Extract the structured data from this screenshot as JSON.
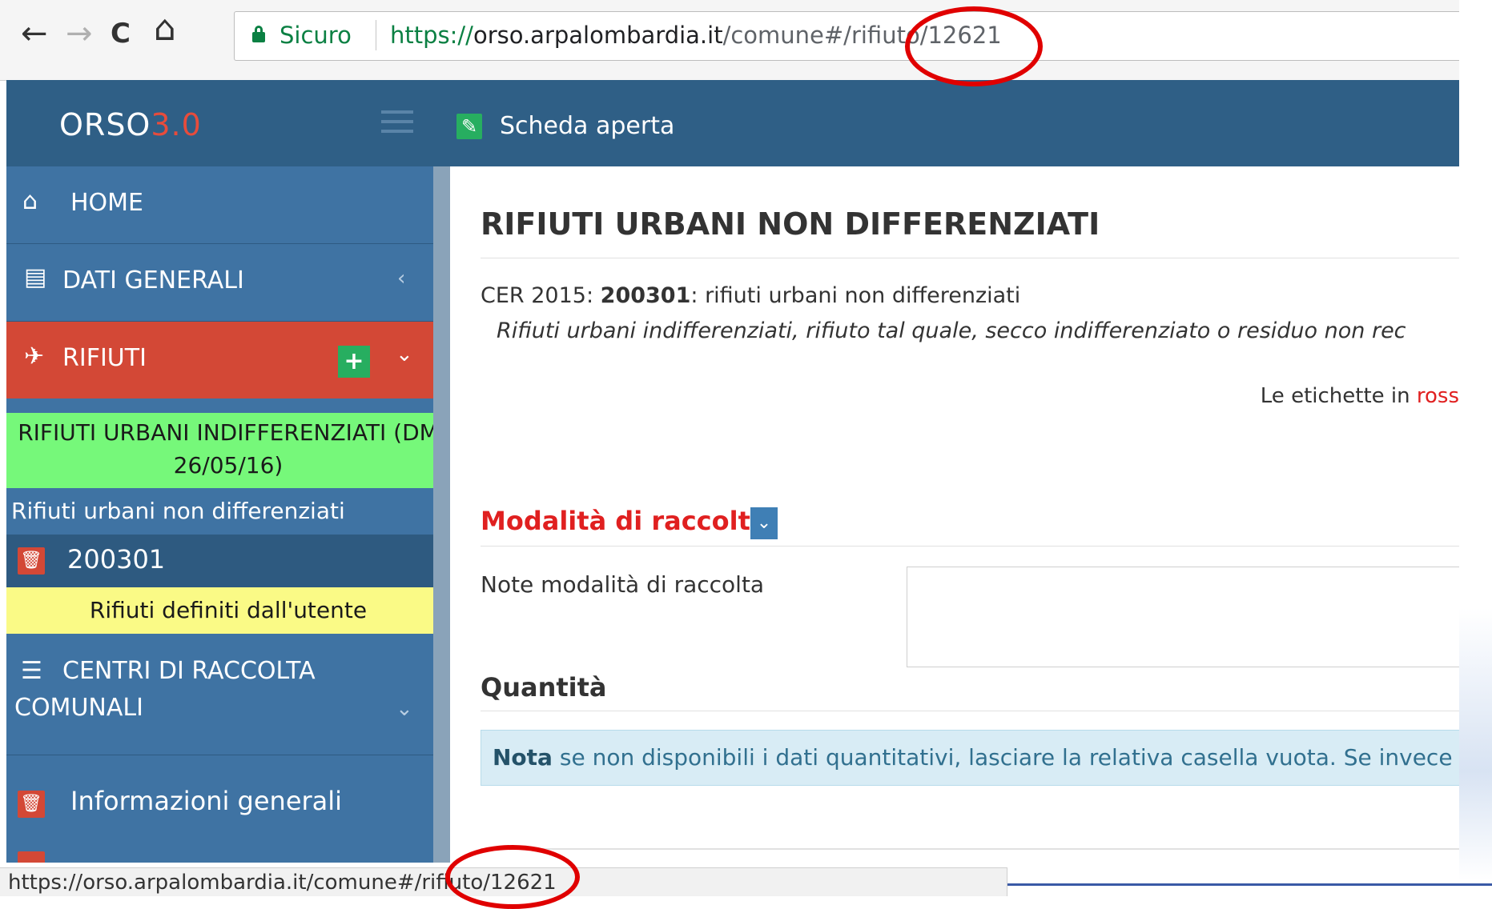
{
  "browser": {
    "back_icon": "←",
    "forward_icon": "→",
    "reload_icon": "C",
    "home_icon": "⌂",
    "secure_label": "Sicuro",
    "url_scheme": "https://",
    "url_host": "orso.arpalombardia.it",
    "url_path": "/comune#/rifiuto/12621"
  },
  "app": {
    "logo_main": "ORSO",
    "logo_version": "3.0",
    "header_status": "Scheda aperta",
    "header_icon": "✎"
  },
  "sidebar": {
    "home": {
      "label": "HOME",
      "icon": "⌂"
    },
    "dati_generali": {
      "label": "DATI GENERALI",
      "icon": "▤",
      "chevron": "‹"
    },
    "rifiuti": {
      "label": "RIFIUTI",
      "icon": "✈",
      "plus": "+",
      "chevron": "⌄"
    },
    "group_line1": "RIFIUTI URBANI INDIFFERENZIATI (DM",
    "group_line2": "26/05/16)",
    "subgroup": "Rifiuti urbani non differenziati",
    "code_item": "200301",
    "user_defined": "Rifiuti definiti dall'utente",
    "centri": {
      "line1": "CENTRI DI RACCOLTA",
      "line2": "COMUNALI",
      "icon": "☰",
      "chevron": "⌄"
    },
    "info_generali": "Informazioni generali",
    "trash_icon": "🗑"
  },
  "content": {
    "title": "RIFIUTI URBANI NON DIFFERENZIATI",
    "cer_prefix": "CER 2015: ",
    "cer_code": "200301",
    "cer_suffix": ": rifiuti urbani non differenziati",
    "cer_description": "Rifiuti urbani indifferenziati, rifiuto tal quale, secco indifferenziato o residuo non rec",
    "labels_note_prefix": "Le etichette in ",
    "labels_note_red": "ross",
    "section_modalita": "Modalità di raccolta",
    "collapse_icon": "⌄",
    "note_modalita_label": "Note modalità di raccolta",
    "note_modalita_value": "",
    "section_quantita": "Quantità",
    "alert_bold": "Nota",
    "alert_text": " se non disponibili i dati quantitativi, lasciare la relativa casella vuota. Se invece i"
  },
  "statusbar": {
    "url": "https://orso.arpalombardia.it/comune#/rifiuto/12621"
  },
  "colors": {
    "header_blue": "#2f5f86",
    "sidebar_blue": "#3f73a3",
    "rifiuti_red": "#d34836",
    "green_band": "#76f87a",
    "yellow_band": "#fafa86",
    "highlight_ring": "#e00000"
  }
}
